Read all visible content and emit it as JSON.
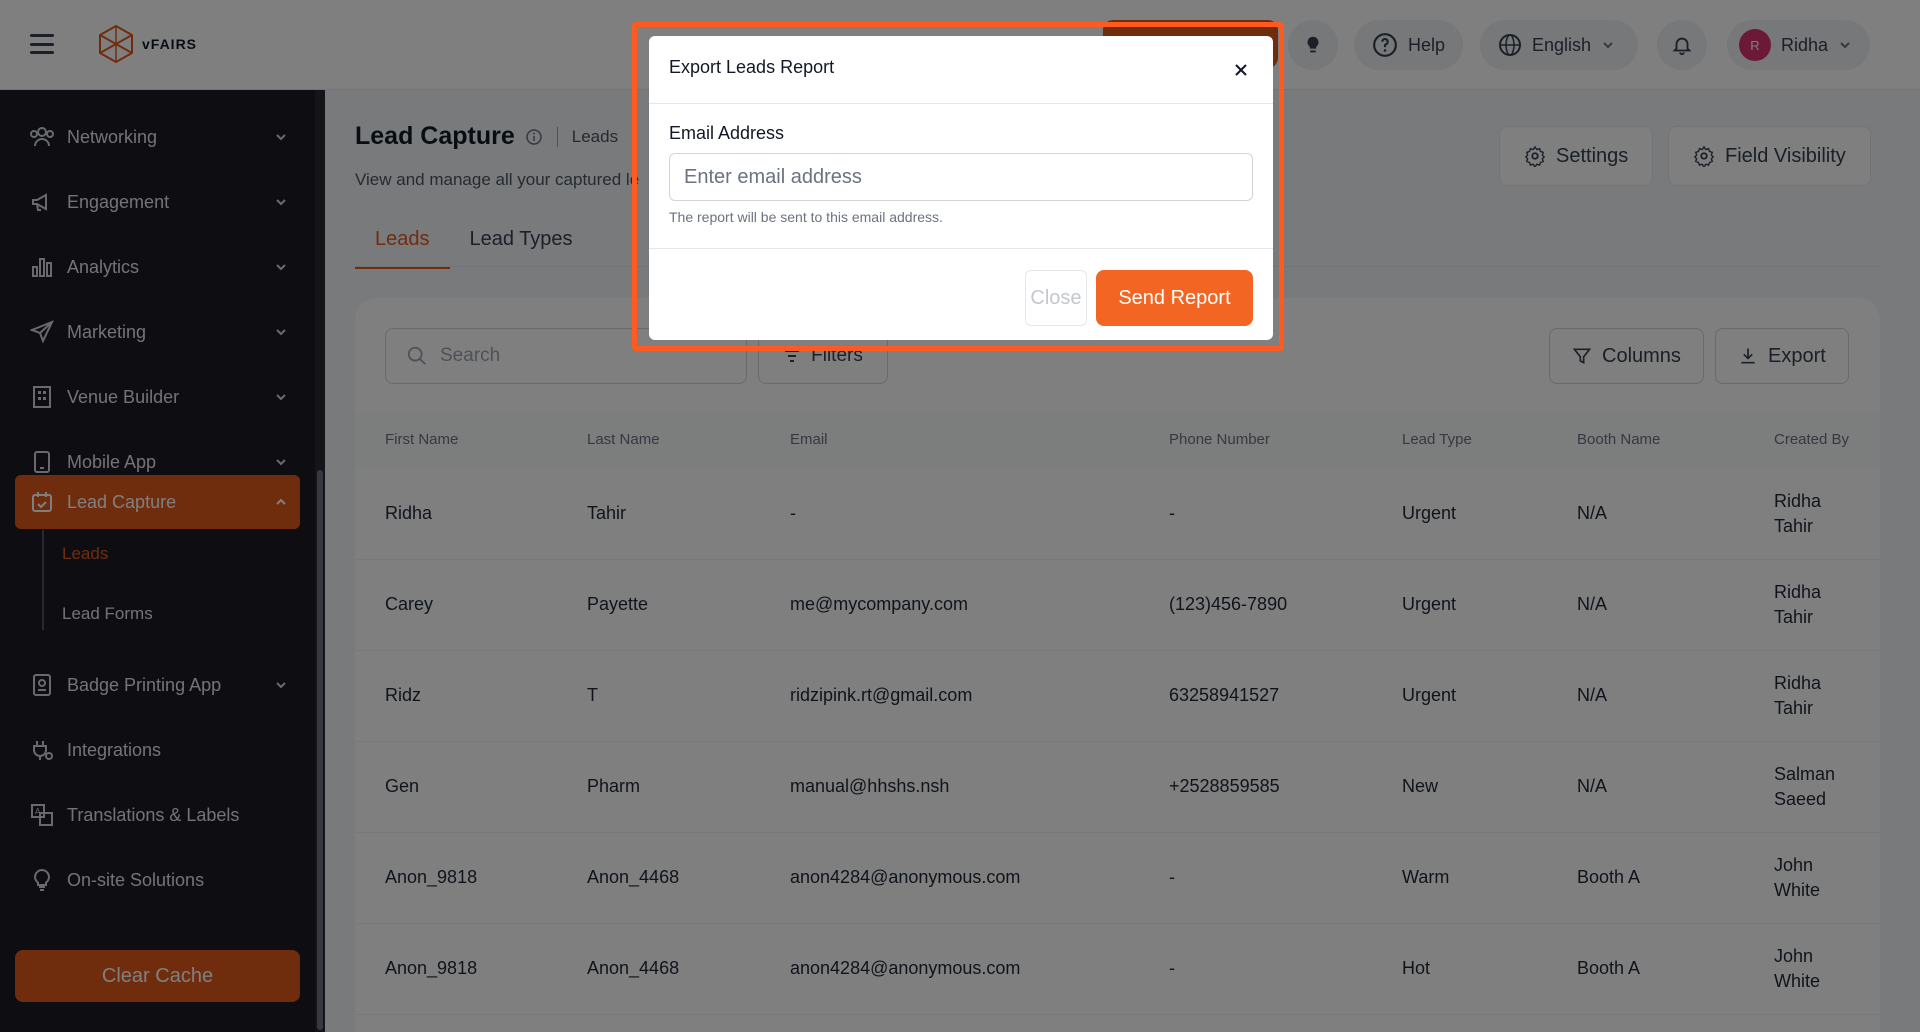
{
  "header": {
    "logo_text": "vFAIRS",
    "help_label": "Help",
    "language_label": "English",
    "user_initial": "R",
    "user_name": "Ridha"
  },
  "sidebar": {
    "items": [
      {
        "label": "Networking",
        "icon": "users-icon"
      },
      {
        "label": "Engagement",
        "icon": "megaphone-icon"
      },
      {
        "label": "Analytics",
        "icon": "bar-chart-icon"
      },
      {
        "label": "Marketing",
        "icon": "paper-plane-icon"
      },
      {
        "label": "Venue Builder",
        "icon": "building-icon"
      },
      {
        "label": "Mobile App",
        "icon": "mobile-icon"
      },
      {
        "label": "Lead Capture",
        "icon": "calendar-check-icon"
      },
      {
        "label": "Badge Printing App",
        "icon": "badge-icon"
      },
      {
        "label": "Integrations",
        "icon": "plug-icon"
      },
      {
        "label": "Translations & Labels",
        "icon": "translate-icon"
      },
      {
        "label": "On-site Solutions",
        "icon": "lightbulb-icon"
      }
    ],
    "lead_capture_sub": [
      "Leads",
      "Lead Forms"
    ],
    "clear_cache_label": "Clear Cache"
  },
  "main": {
    "title": "Lead Capture",
    "breadcrumb": "Leads",
    "description": "View and manage all your captured le",
    "settings_label": "Settings",
    "field_visibility_label": "Field Visibility",
    "tabs": [
      "Leads",
      "Lead Types"
    ],
    "search_placeholder": "Search",
    "filters_label": "Filters",
    "columns_label": "Columns",
    "export_label": "Export",
    "table": {
      "columns": [
        "First Name",
        "Last Name",
        "Email",
        "Phone Number",
        "Lead Type",
        "Booth Name",
        "Created By"
      ],
      "rows": [
        [
          "Ridha",
          "Tahir",
          "-",
          "-",
          "Urgent",
          "N/A",
          "Ridha Tahir"
        ],
        [
          "Carey",
          "Payette",
          "me@mycompany.com",
          "(123)456-7890",
          "Urgent",
          "N/A",
          "Ridha Tahir"
        ],
        [
          "Ridz",
          "T",
          "ridzipink.rt@gmail.com",
          "63258941527",
          "Urgent",
          "N/A",
          "Ridha Tahir"
        ],
        [
          "Gen",
          "Pharm",
          "manual@hhshs.nsh",
          "+2528859585",
          "New",
          "N/A",
          "Salman Saeed"
        ],
        [
          "Anon_9818",
          "Anon_4468",
          "anon4284@anonymous.com",
          "-",
          "Warm",
          "Booth A",
          "John White"
        ],
        [
          "Anon_9818",
          "Anon_4468",
          "anon4284@anonymous.com",
          "-",
          "Hot",
          "Booth A",
          "John White"
        ]
      ]
    }
  },
  "modal": {
    "title": "Export Leads Report",
    "email_label": "Email Address",
    "email_placeholder": "Enter email address",
    "email_value": "",
    "help_text": "The report will be sent to this email address.",
    "close_label": "Close",
    "send_label": "Send Report"
  },
  "colors": {
    "accent": "#e15b1b",
    "sidebar_bg": "#1c1c24",
    "highlight": "#ff5a1f"
  }
}
